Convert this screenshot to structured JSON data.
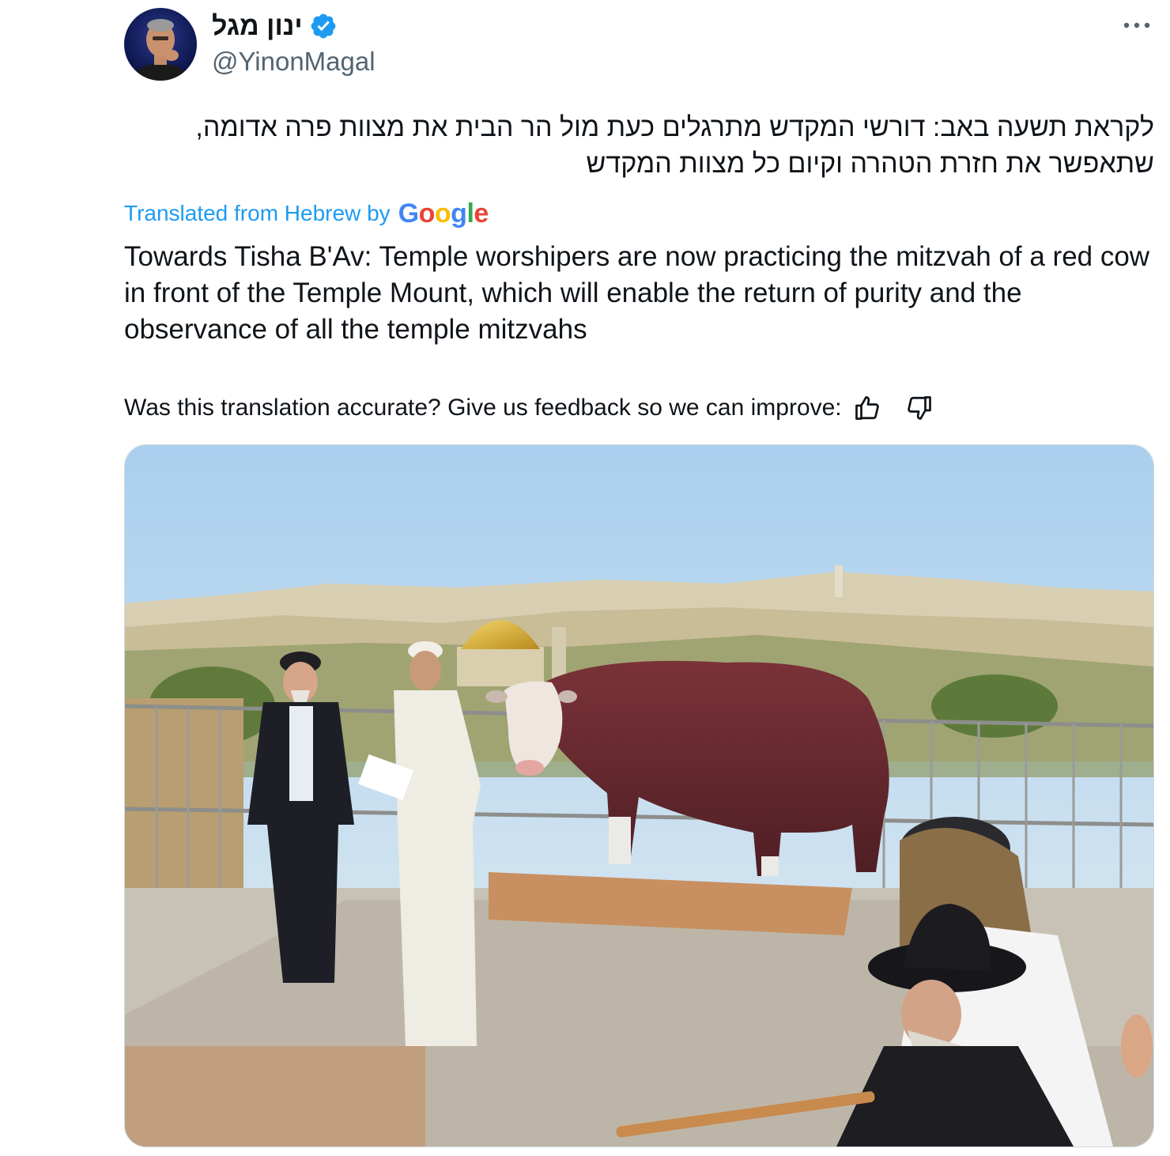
{
  "author": {
    "display_name": "ינון מגל",
    "handle": "@YinonMagal",
    "verified": true
  },
  "tweet": {
    "hebrew_text": "לקראת תשעה באב: דורשי המקדש מתרגלים כעת מול הר הבית את מצוות פרה אדומה, שתאפשר את חזרת הטהרה וקיום כל מצוות המקדש",
    "translated_from_label": "Translated from Hebrew by",
    "translation_provider_logo": "Google",
    "english_text": "Towards Tisha B'Av: Temple worshipers are now practicing the mitzvah of a red cow in front of the Temple Mount, which will enable the return of purity and the observance of all the temple mitzvahs"
  },
  "feedback": {
    "prompt": "Was this translation accurate? Give us feedback so we can improve:"
  },
  "icons": {
    "verified": "verified-badge-icon",
    "more": "more-horizontal-icon",
    "thumbs_up": "thumbs-up-icon",
    "thumbs_down": "thumbs-down-icon"
  },
  "colors": {
    "link_blue": "#1d9bf0",
    "secondary_text": "#536471",
    "primary_text": "#0f1419",
    "google_blue": "#4285f4",
    "google_red": "#ea4335",
    "google_yellow": "#fbbc05",
    "google_green": "#34a853"
  }
}
